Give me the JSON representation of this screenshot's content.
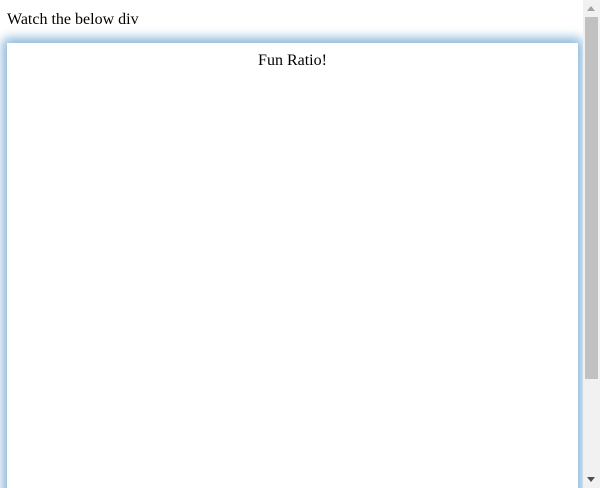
{
  "page": {
    "intro_text": "Watch the below div"
  },
  "box": {
    "title": "Fun Ratio!",
    "shadow_color": "#8fb8d8"
  },
  "scrollbar": {
    "up_icon": "triangle-up",
    "down_icon": "triangle-down"
  }
}
